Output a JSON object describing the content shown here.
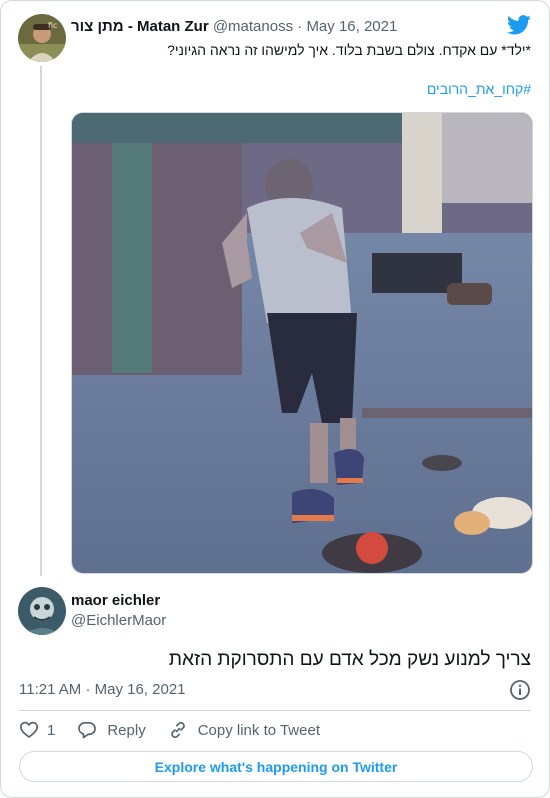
{
  "parent_tweet": {
    "display_name": "מתן צור - Matan Zur",
    "handle": "@matanoss",
    "separator": "·",
    "date": "May 16, 2021",
    "text": "*ילד* עם אקדח. צולם בשבת בלוד. איך למישהו זה נראה הגיוני?",
    "hashtag": "#קחו_את_הרובים",
    "avatar_icon": "user-avatar-photo",
    "media_icon": "video-still-photo"
  },
  "main_tweet": {
    "display_name": "maor eichler",
    "handle": "@EichlerMaor",
    "text": "צריך למנוע נשק מכל אדם עם התסרוקת הזאת",
    "time": "11:21 AM",
    "separator": "·",
    "date": "May 16, 2021",
    "avatar_icon": "user-avatar-photo"
  },
  "actions": {
    "like_count": "1",
    "reply_label": "Reply",
    "copy_link_label": "Copy link to Tweet"
  },
  "explore_label": "Explore what's happening on Twitter",
  "colors": {
    "accent": "#1d9bf0",
    "secondary_text": "#536471",
    "border": "#cfd9de"
  }
}
